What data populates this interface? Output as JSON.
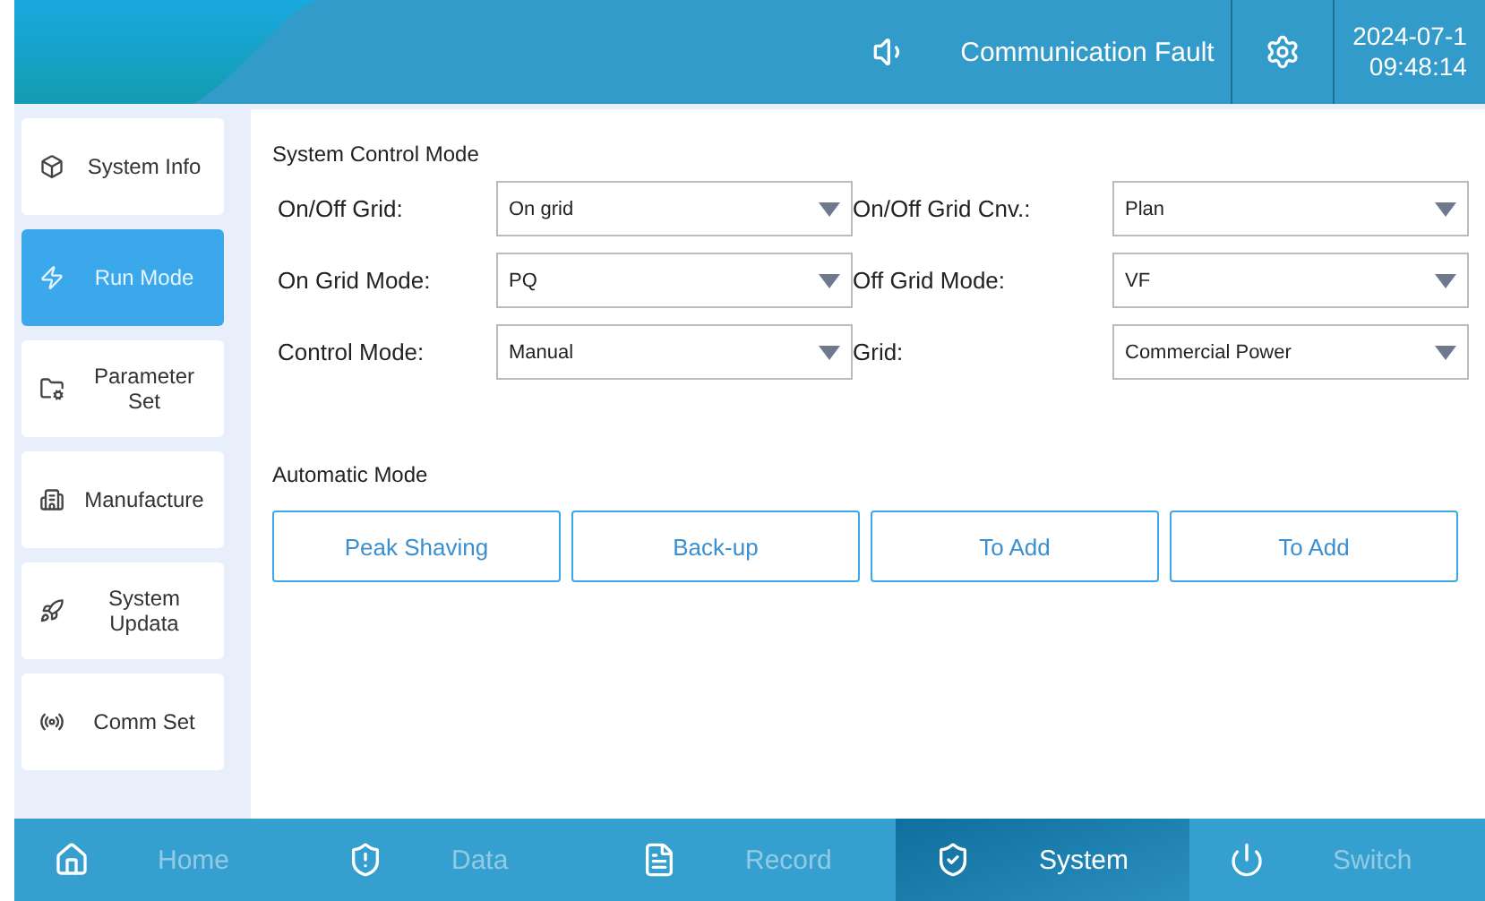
{
  "header": {
    "alarm": "Communication Fault",
    "date": "2024-07-1",
    "time": "09:48:14"
  },
  "sidebar": {
    "items": [
      {
        "label": "System Info",
        "selected": false
      },
      {
        "label": "Run Mode",
        "selected": true
      },
      {
        "label": "Parameter Set",
        "selected": false
      },
      {
        "label": "Manufacture",
        "selected": false
      },
      {
        "label": "System Updata",
        "selected": false
      },
      {
        "label": "Comm Set",
        "selected": false
      }
    ]
  },
  "control_mode": {
    "title": "System Control Mode",
    "fields": [
      {
        "label": "On/Off Grid:",
        "value": "On grid"
      },
      {
        "label": "On/Off Grid Cnv.:",
        "value": "Plan"
      },
      {
        "label": "On Grid Mode:",
        "value": "PQ"
      },
      {
        "label": "Off Grid Mode:",
        "value": "VF"
      },
      {
        "label": "Control Mode:",
        "value": "Manual"
      },
      {
        "label": "Grid:",
        "value": "Commercial Power"
      }
    ]
  },
  "automatic_mode": {
    "title": "Automatic Mode",
    "buttons": [
      "Peak Shaving",
      "Back-up",
      "To Add",
      "To Add"
    ]
  },
  "bottom_nav": [
    {
      "label": "Home",
      "selected": false
    },
    {
      "label": "Data",
      "selected": false
    },
    {
      "label": "Record",
      "selected": false
    },
    {
      "label": "System",
      "selected": true
    },
    {
      "label": "Switch",
      "selected": false
    }
  ]
}
